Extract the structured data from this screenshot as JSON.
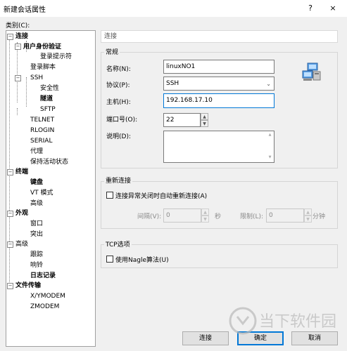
{
  "window": {
    "title": "新建会话属性",
    "help": "?",
    "close": "×"
  },
  "category_label": "类别(C):",
  "tree": [
    {
      "label": "连接",
      "bold": true
    },
    {
      "label": "用户身份验证",
      "bold": true
    },
    {
      "label": "登录提示符",
      "bold": false
    },
    {
      "label": "登录脚本",
      "bold": false
    },
    {
      "label": "SSH",
      "bold": false
    },
    {
      "label": "安全性",
      "bold": false
    },
    {
      "label": "隧道",
      "bold": true
    },
    {
      "label": "SFTP",
      "bold": false
    },
    {
      "label": "TELNET",
      "bold": false
    },
    {
      "label": "RLOGIN",
      "bold": false
    },
    {
      "label": "SERIAL",
      "bold": false
    },
    {
      "label": "代理",
      "bold": false
    },
    {
      "label": "保持活动状态",
      "bold": false
    },
    {
      "label": "终端",
      "bold": true
    },
    {
      "label": "键盘",
      "bold": true
    },
    {
      "label": "VT 模式",
      "bold": false
    },
    {
      "label": "高级",
      "bold": false
    },
    {
      "label": "外观",
      "bold": true
    },
    {
      "label": "窗口",
      "bold": false
    },
    {
      "label": "突出",
      "bold": false
    },
    {
      "label": "高级",
      "bold": false
    },
    {
      "label": "跟踪",
      "bold": false
    },
    {
      "label": "响铃",
      "bold": false
    },
    {
      "label": "日志记录",
      "bold": true
    },
    {
      "label": "文件传输",
      "bold": true
    },
    {
      "label": "X/YMODEM",
      "bold": false
    },
    {
      "label": "ZMODEM",
      "bold": false
    }
  ],
  "panel_header": "连接",
  "general": {
    "title": "常规",
    "name_label": "名称(N):",
    "name_value": "linuxNO1",
    "protocol_label": "协议(P):",
    "protocol_value": "SSH",
    "host_label": "主机(H):",
    "host_value": "192.168.17.10",
    "port_label": "端口号(O):",
    "port_value": "22",
    "desc_label": "说明(D):",
    "desc_value": ""
  },
  "reconnect": {
    "title": "重新连接",
    "auto_label": "连接异常关闭时自动重新连接(A)",
    "interval_label": "间隔(V):",
    "interval_value": "0",
    "interval_unit": "秒",
    "limit_label": "限制(L):",
    "limit_value": "0",
    "limit_unit": "分钟"
  },
  "tcp": {
    "title": "TCP选项",
    "nagle_label": "使用Nagle算法(U)"
  },
  "buttons": {
    "connect": "连接",
    "ok": "确定",
    "cancel": "取消"
  },
  "watermark": "当下软件园"
}
